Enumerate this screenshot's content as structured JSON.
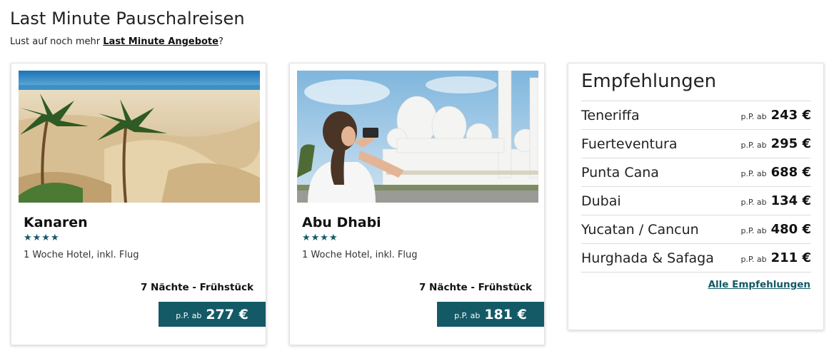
{
  "header": {
    "title": "Last Minute Pauschalreisen",
    "subtitle_prefix": "Lust auf noch mehr ",
    "subtitle_link": "Last Minute Angebote",
    "subtitle_suffix": "?"
  },
  "cards": [
    {
      "destination": "Kanaren",
      "stars": "★★★★",
      "star_count": 4,
      "description": "1 Woche Hotel, inkl. Flug",
      "board": "7 Nächte - Frühstück",
      "price_prefix": "p.P. ab",
      "price": "277 €",
      "image": "desert-dunes-palms-beach"
    },
    {
      "destination": "Abu Dhabi",
      "stars": "★★★★",
      "star_count": 4,
      "description": "1 Woche Hotel, inkl. Flug",
      "board": "7 Nächte - Frühstück",
      "price_prefix": "p.P. ab",
      "price": "181 €",
      "image": "woman-photographing-mosque"
    }
  ],
  "recommendations": {
    "title": "Empfehlungen",
    "price_prefix": "p.P. ab",
    "items": [
      {
        "name": "Teneriffa",
        "price": "243 €"
      },
      {
        "name": "Fuerteventura",
        "price": "295 €"
      },
      {
        "name": "Punta Cana",
        "price": "688 €"
      },
      {
        "name": "Dubai",
        "price": "134 €"
      },
      {
        "name": "Yucatan / Cancun",
        "price": "480 €"
      },
      {
        "name": "Hurghada & Safaga",
        "price": "211 €"
      }
    ],
    "all_link": "Alle Empfehlungen"
  },
  "colors": {
    "accent": "#135a66",
    "text": "#1a1a1a"
  }
}
